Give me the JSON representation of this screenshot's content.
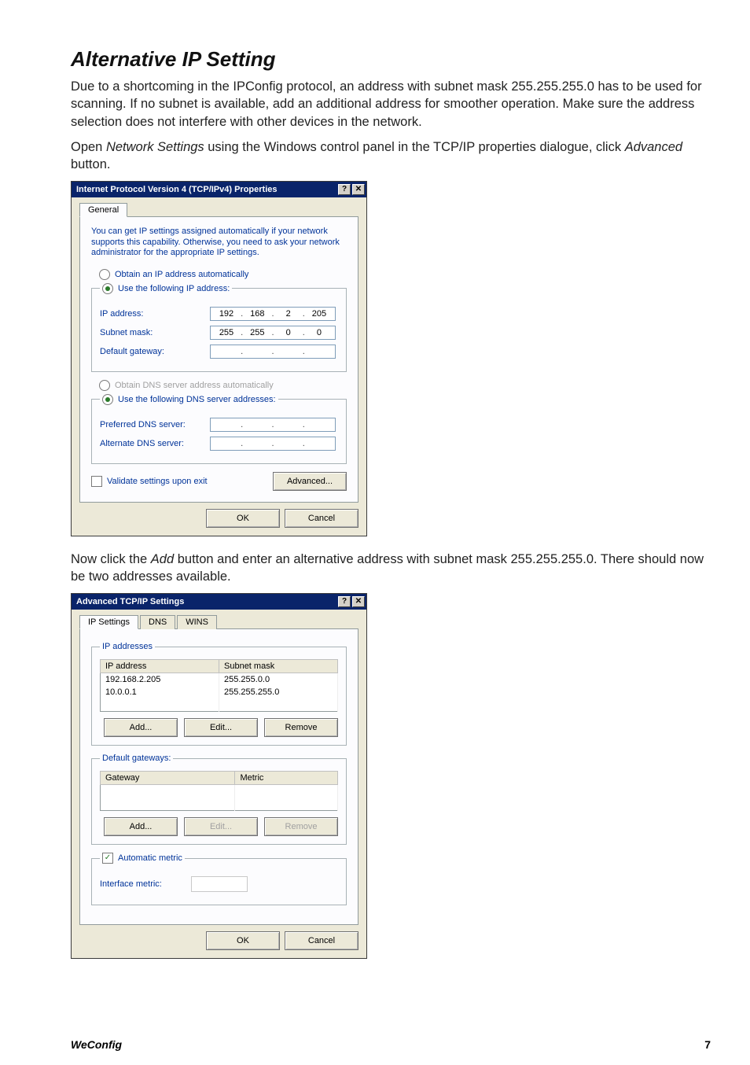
{
  "heading": "Alternative IP Setting",
  "para1": "Due to a shortcoming in the IPConfig protocol, an address with subnet mask 255.255.255.0 has to be used for scanning. If no subnet is available, add an additional address for smoother operation. Make sure the address selection does not interfere with other devices in the network.",
  "para2_a": "Open ",
  "para2_ital1": "Network Settings",
  "para2_b": " using the Windows control panel in the TCP/IP properties dialogue, click ",
  "para2_ital2": "Advanced",
  "para2_c": " button.",
  "para3_a": "Now click the ",
  "para3_ital": "Add",
  "para3_b": " button and enter an alternative address with subnet mask 255.255.255.0. There should now be two addresses available.",
  "footer": {
    "brand": "WeConfig",
    "page": "7"
  },
  "dlg1": {
    "title": "Internet Protocol Version 4 (TCP/IPv4) Properties",
    "help_btn": "?",
    "close_btn": "✕",
    "tab_general": "General",
    "help_text": "You can get IP settings assigned automatically if your network supports this capability. Otherwise, you need to ask your network administrator for the appropriate IP settings.",
    "radio_auto_ip": "Obtain an IP address automatically",
    "radio_use_ip": "Use the following IP address:",
    "lbl_ip": "IP address:",
    "ip": [
      "192",
      "168",
      "2",
      "205"
    ],
    "lbl_subnet": "Subnet mask:",
    "subnet": [
      "255",
      "255",
      "0",
      "0"
    ],
    "lbl_gateway": "Default gateway:",
    "gateway": [
      "",
      "",
      "",
      ""
    ],
    "radio_auto_dns": "Obtain DNS server address automatically",
    "radio_use_dns": "Use the following DNS server addresses:",
    "lbl_pref_dns": "Preferred DNS server:",
    "pref_dns": [
      "",
      "",
      "",
      ""
    ],
    "lbl_alt_dns": "Alternate DNS server:",
    "alt_dns": [
      "",
      "",
      "",
      ""
    ],
    "chk_validate": "Validate settings upon exit",
    "btn_advanced": "Advanced...",
    "btn_ok": "OK",
    "btn_cancel": "Cancel"
  },
  "dlg2": {
    "title": "Advanced TCP/IP Settings",
    "help_btn": "?",
    "close_btn": "✕",
    "tabs": {
      "ip": "IP Settings",
      "dns": "DNS",
      "wins": "WINS"
    },
    "group_ip": "IP addresses",
    "col_ip": "IP address",
    "col_mask": "Subnet mask",
    "rows": [
      {
        "ip": "192.168.2.205",
        "mask": "255.255.0.0"
      },
      {
        "ip": "10.0.0.1",
        "mask": "255.255.255.0"
      }
    ],
    "btn_add": "Add...",
    "btn_edit": "Edit...",
    "btn_remove": "Remove",
    "group_gw": "Default gateways:",
    "col_gw": "Gateway",
    "col_metric": "Metric",
    "chk_auto_metric": "Automatic metric",
    "lbl_if_metric": "Interface metric:",
    "btn_ok": "OK",
    "btn_cancel": "Cancel"
  }
}
